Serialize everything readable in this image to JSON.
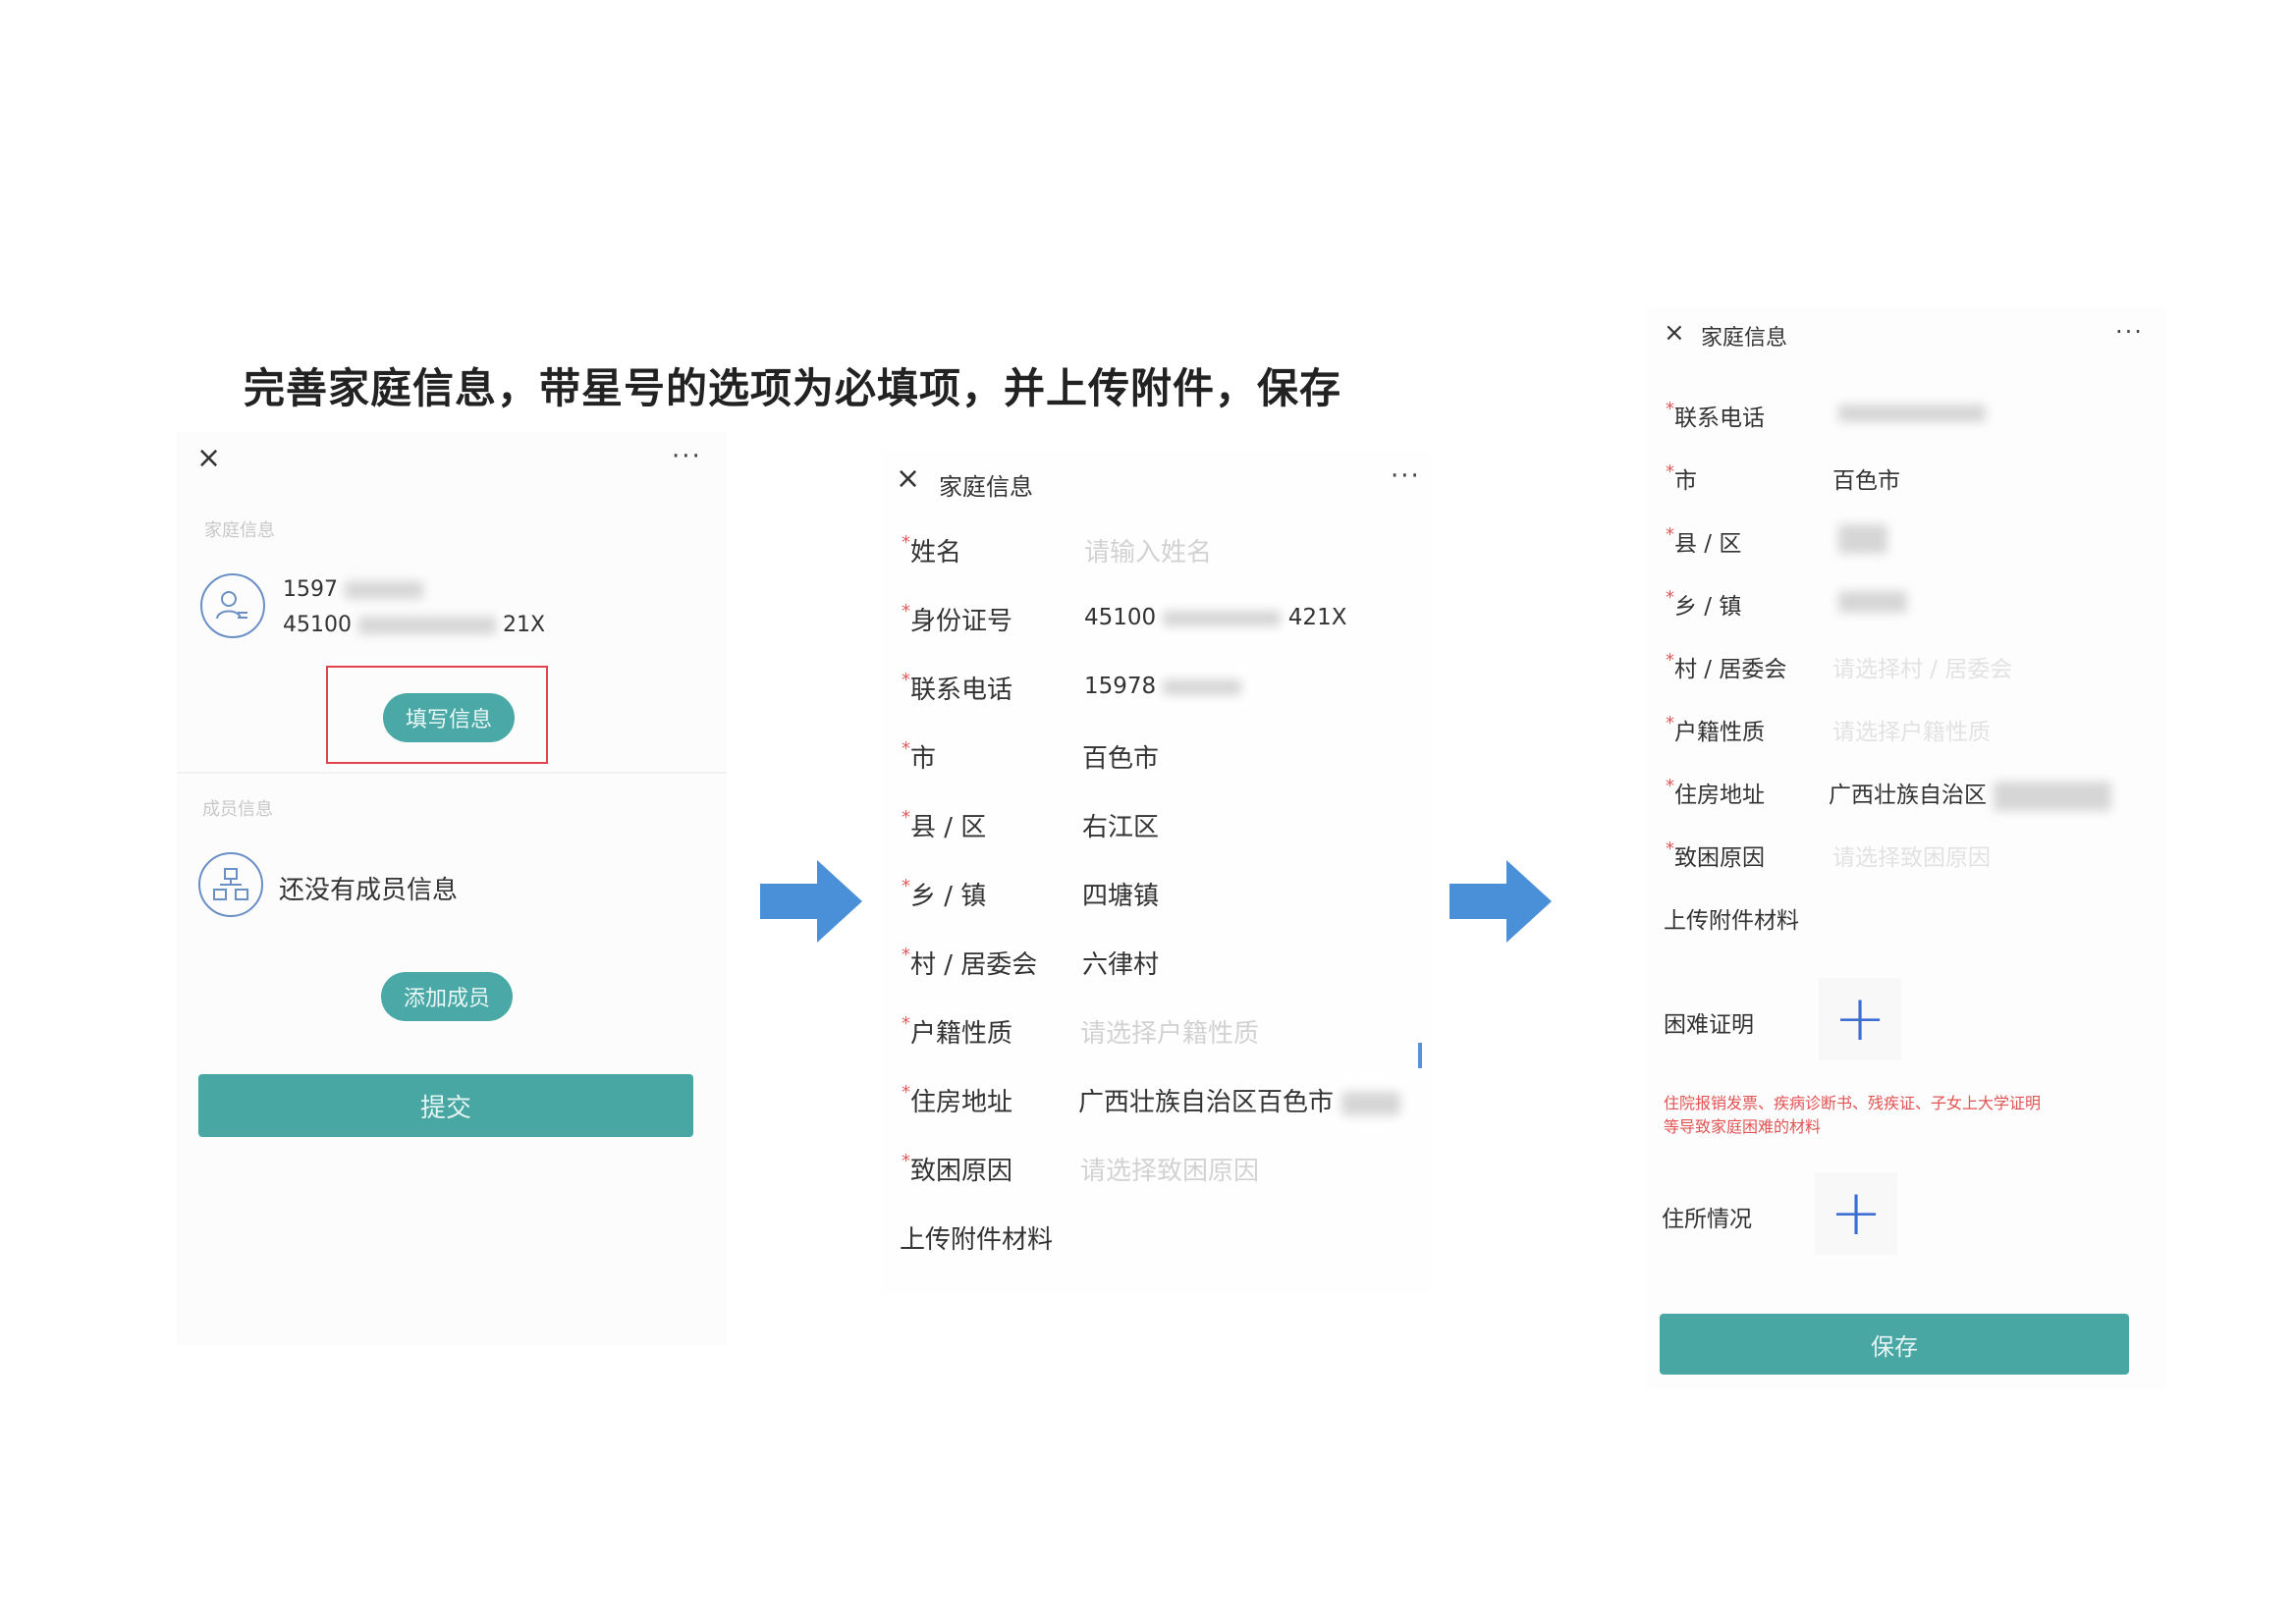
{
  "instruction": "完善家庭信息，带星号的选项为必填项，并上传附件，保存",
  "colors": {
    "accent": "#4aa9a6",
    "required": "#e05a5a",
    "plus": "#3c6fd1",
    "arrow": "#4a90d9"
  },
  "panel1": {
    "close_icon": "×",
    "more_icon": "···",
    "section_family": "家庭信息",
    "phone_prefix": "1597",
    "id_prefix": "45100",
    "id_suffix": "21X",
    "fill_button": "填写信息",
    "section_members": "成员信息",
    "no_members": "还没有成员信息",
    "add_member_button": "添加成员",
    "submit_button": "提交"
  },
  "panel2": {
    "close_icon": "×",
    "title": "家庭信息",
    "more_icon": "···",
    "fields": [
      {
        "label": "姓名",
        "value": "",
        "placeholder": "请输入姓名"
      },
      {
        "label": "身份证号",
        "value": "45100",
        "suffix": "421X"
      },
      {
        "label": "联系电话",
        "value": "15978"
      },
      {
        "label": "市",
        "value": "百色市"
      },
      {
        "label": "县 / 区",
        "value": "右江区"
      },
      {
        "label": "乡 / 镇",
        "value": "四塘镇"
      },
      {
        "label": "村 / 居委会",
        "value": "六律村"
      },
      {
        "label": "户籍性质",
        "value": "",
        "placeholder": "请选择户籍性质"
      },
      {
        "label": "住房地址",
        "value": "广西壮族自治区百色市"
      },
      {
        "label": "致困原因",
        "value": "",
        "placeholder": "请选择致困原因"
      }
    ],
    "upload_section": "上传附件材料"
  },
  "panel3": {
    "close_icon": "×",
    "title": "家庭信息",
    "more_icon": "···",
    "fields": [
      {
        "label": "联系电话",
        "value": ""
      },
      {
        "label": "市",
        "value": "百色市"
      },
      {
        "label": "县 / 区",
        "value": ""
      },
      {
        "label": "乡 / 镇",
        "value": ""
      },
      {
        "label": "村 / 居委会",
        "value": "",
        "placeholder": "请选择村 / 居委会"
      },
      {
        "label": "户籍性质",
        "value": "",
        "placeholder": "请选择户籍性质"
      },
      {
        "label": "住房地址",
        "value": "广西壮族自治区"
      },
      {
        "label": "致困原因",
        "value": "",
        "placeholder": "请选择致困原因"
      }
    ],
    "upload_section": "上传附件材料",
    "difficulty_proof": "困难证明",
    "plus_icon": "+",
    "note_line1": "住院报销发票、疾病诊断书、残疾证、子女上大学证明",
    "note_line2": "等导致家庭困难的材料",
    "residence": "住所情况",
    "save_button": "保存"
  }
}
